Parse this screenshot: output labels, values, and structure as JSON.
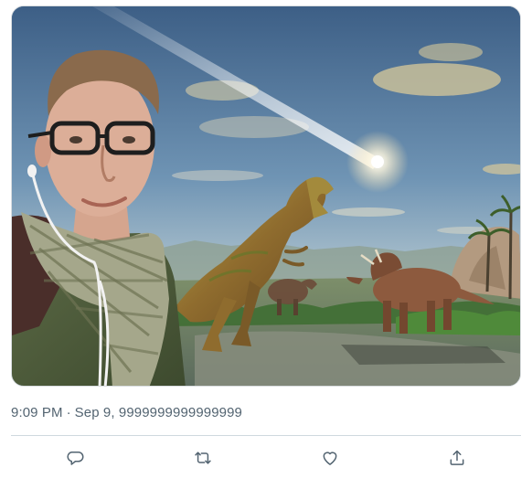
{
  "tweet": {
    "media": {
      "icon": "photo-dinosaurs-meteor-selfie"
    },
    "time": "9:09 PM",
    "separator": "·",
    "date": "Sep 9, 9999999999999999"
  },
  "actions": [
    {
      "name": "reply",
      "icon": "speech-bubble-icon"
    },
    {
      "name": "retweet",
      "icon": "retweet-arrows-icon"
    },
    {
      "name": "like",
      "icon": "heart-icon"
    },
    {
      "name": "share",
      "icon": "share-upload-icon"
    }
  ],
  "colors": {
    "meta_text": "#536471",
    "divider": "#cfd9de",
    "icon": "#536471"
  }
}
